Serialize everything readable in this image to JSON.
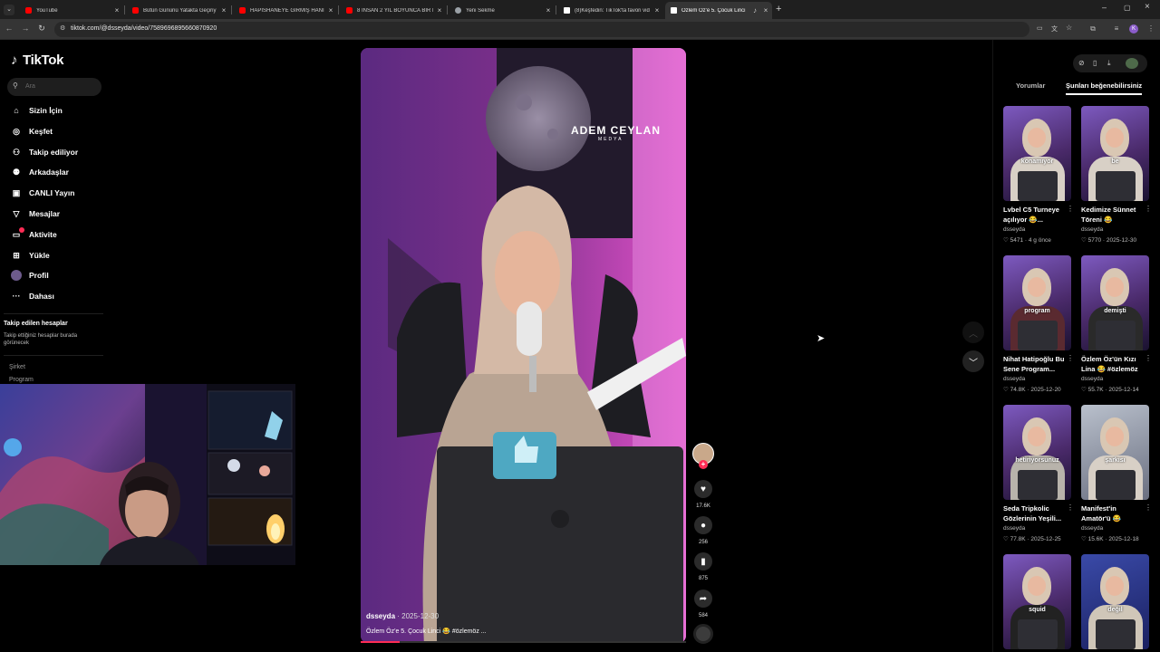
{
  "browser": {
    "tabs": [
      {
        "title": "YouTube",
        "favicon": "youtube-icon",
        "color": "#ff0000"
      },
      {
        "title": "Bütün Gününü Yatakta Geçiriy",
        "favicon": "youtube-icon",
        "color": "#ff0000"
      },
      {
        "title": "HAPİSHANEYE GİRMİŞ HANIM",
        "favicon": "youtube-icon",
        "color": "#ff0000"
      },
      {
        "title": "8 İNSAN 2 YIL BOYUNCA BİR K",
        "favicon": "youtube-icon",
        "color": "#ff0000"
      },
      {
        "title": "Yeni Sekme",
        "favicon": "chrome-icon",
        "color": "#9aa0a6"
      },
      {
        "title": "(8)Keşfedin: TikTok'ta favori vid",
        "favicon": "tiktok-icon",
        "color": "#ffffff"
      },
      {
        "title": "Özlem Öz'e 5. Çocuk Linci",
        "favicon": "tiktok-icon",
        "color": "#ffffff"
      }
    ],
    "url": "tiktok.com/@dsseyda/video/7589696895660870920",
    "profile_initial": "K"
  },
  "sidebar": {
    "logo": "TikTok",
    "search_placeholder": "Ara",
    "items": [
      {
        "label": "Sizin İçin",
        "icon": "home-icon"
      },
      {
        "label": "Keşfet",
        "icon": "compass-icon"
      },
      {
        "label": "Takip ediliyor",
        "icon": "following-icon"
      },
      {
        "label": "Arkadaşlar",
        "icon": "friends-icon"
      },
      {
        "label": "CANLI Yayın",
        "icon": "live-icon"
      },
      {
        "label": "Mesajlar",
        "icon": "messages-icon"
      },
      {
        "label": "Aktivite",
        "icon": "activity-icon"
      },
      {
        "label": "Yükle",
        "icon": "upload-icon"
      },
      {
        "label": "Profil",
        "icon": "profile-icon"
      },
      {
        "label": "Dahası",
        "icon": "more-icon"
      }
    ],
    "following_title": "Takip edilen hesaplar",
    "following_note": "Takip ettiğiniz hesaplar burada görünecek",
    "footer": [
      "Şirket",
      "Program"
    ]
  },
  "video": {
    "watermark_line1": "ADEM CEYLAN",
    "watermark_line2": "MEDYA",
    "author": "dsseyda",
    "date": "· 2025-12-30",
    "caption": "Özlem Öz'e 5. Çocuk Linci 😂 #özlemöz ...",
    "progress": 0.12,
    "likes": "17.6K",
    "comments": "256",
    "saves": "875",
    "shares": "584"
  },
  "right_panel": {
    "tabs": [
      "Yorumlar",
      "Şunları beğenebilirsiniz"
    ],
    "active_tab": 1,
    "cards": [
      {
        "title": "Lvbel C5 Turneye açılıyor 😂...",
        "author": "dsseyda",
        "likes": "5471",
        "date": "4 g önce",
        "overlay": "konamıyor"
      },
      {
        "title": "Kedimize Sünnet Töreni 😂",
        "author": "dsseyda",
        "likes": "5770",
        "date": "2025-12-30",
        "overlay": "be"
      },
      {
        "title": "Nihat Hatipoğlu Bu Sene Program...",
        "author": "dsseyda",
        "likes": "74.8K",
        "date": "2025-12-20",
        "overlay": "program"
      },
      {
        "title": "Özlem Öz'ün Kızı Lina 😂 #özlemöz",
        "author": "dsseyda",
        "likes": "55.7K",
        "date": "2025-12-14",
        "overlay": "demişti"
      },
      {
        "title": "Seda Tripkolic Gözlerinin Yeşili...",
        "author": "dsseyda",
        "likes": "77.8K",
        "date": "2025-12-25",
        "overlay": "hetiriyorsunuz"
      },
      {
        "title": "Manifest'in Amatör'ü 😂",
        "author": "dsseyda",
        "likes": "15.6K",
        "date": "2025-12-18",
        "overlay": "şarkısı"
      },
      {
        "title": "",
        "author": "",
        "likes": "",
        "date": "",
        "overlay": "squid"
      },
      {
        "title": "",
        "author": "",
        "likes": "",
        "date": "",
        "overlay": "değil"
      }
    ]
  }
}
